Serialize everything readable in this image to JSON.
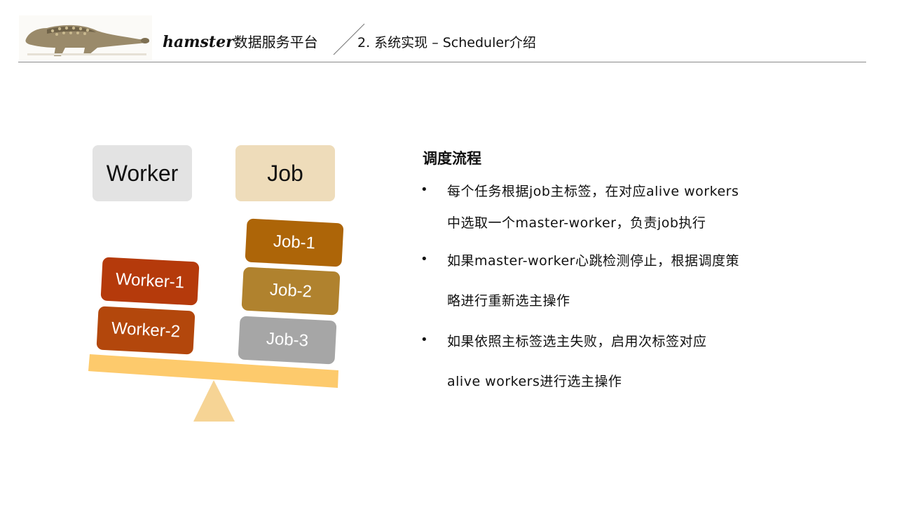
{
  "header": {
    "brand_latin": "hamster",
    "brand_cjk": "数据服务平台",
    "slide_title": "2. 系统实现 – Scheduler介绍"
  },
  "legend": {
    "worker": "Worker",
    "job": "Job"
  },
  "blocks": {
    "workers": [
      "Worker-1",
      "Worker-2"
    ],
    "jobs": [
      "Job-1",
      "Job-2",
      "Job-3"
    ]
  },
  "flow": {
    "title": "调度流程",
    "bullets": [
      {
        "lines": [
          "每个任务根据job主标签，在对应alive workers",
          "中选取一个master-worker，负责job执行"
        ]
      },
      {
        "lines": [
          "如果master-worker心跳检测停止，根据调度策",
          "略进行重新选主操作"
        ]
      },
      {
        "lines": [
          "如果依照主标签选主失败，启用次标签对应",
          "alive workers进行选主操作"
        ]
      }
    ]
  },
  "colors": {
    "worker_legend": "#e3e3e3",
    "job_legend": "#eedcba",
    "worker_1": "#b53a0b",
    "worker_2": "#b3470c",
    "job_1": "#ad6508",
    "job_2": "#b0822e",
    "job_3": "#a6a6a6",
    "beam": "#fdca6c",
    "fulcrum": "#f6d495"
  }
}
